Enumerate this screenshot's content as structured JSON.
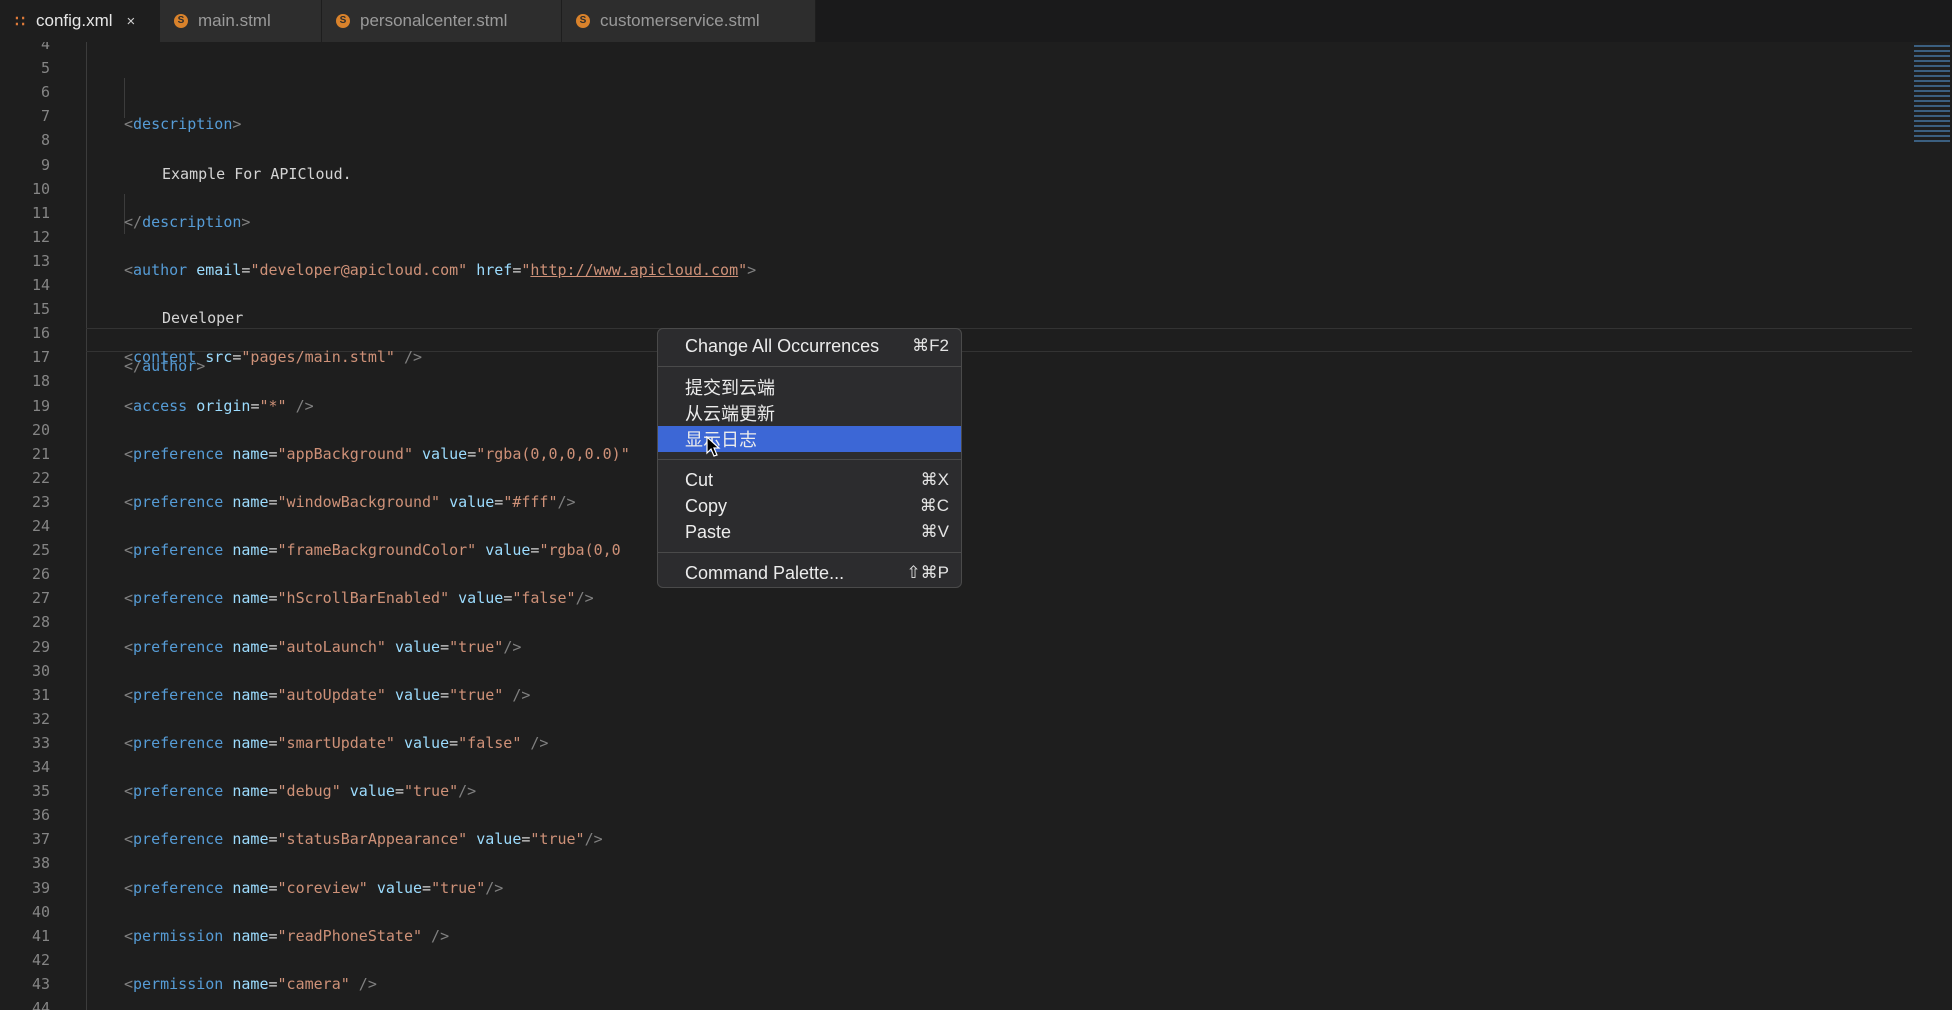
{
  "tabs": [
    {
      "label": "config.xml",
      "icon": "rss-icon",
      "active": true
    },
    {
      "label": "main.stml",
      "icon": "stml-icon"
    },
    {
      "label": "personalcenter.stml",
      "icon": "stml-icon"
    },
    {
      "label": "customerservice.stml",
      "icon": "stml-icon"
    }
  ],
  "tab_close": "×",
  "line_numbers": [
    "4",
    "5",
    "6",
    "7",
    "8",
    "9",
    "10",
    "11",
    "12",
    "13",
    "14",
    "15",
    "16",
    "17",
    "18",
    "19",
    "20",
    "21",
    "22",
    "23",
    "24",
    "25",
    "26",
    "27",
    "28",
    "29",
    "30",
    "31",
    "32",
    "33",
    "34",
    "35",
    "36",
    "37",
    "38",
    "39",
    "40",
    "41",
    "42",
    "43",
    "44"
  ],
  "code": {
    "l5": {
      "open": "<",
      "tag": "description",
      "close": ">"
    },
    "l7": {
      "text": "Example For APICloud."
    },
    "l9": {
      "open": "</",
      "tag": "description",
      "close": ">"
    },
    "l11": {
      "tag": "author",
      "a1": "email",
      "v1": "\"developer@apicloud.com\"",
      "a2": "href",
      "q": "\"",
      "url": "http://www.apicloud.com"
    },
    "l13": {
      "text": "Developer"
    },
    "l15": {
      "tag": "author"
    },
    "l17": {
      "tag": "content",
      "a1": "src",
      "v1": "\"pages/main.stml\"",
      "end": " />"
    },
    "l19": {
      "tag": "access",
      "a1": "origin",
      "v1": "\"*\"",
      "end": " />"
    },
    "l21": {
      "tag": "preference",
      "a1": "name",
      "v1": "\"appBackground\"",
      "a2": "value",
      "v2": "\"rgba(0,0,0,0.0)\""
    },
    "l23": {
      "tag": "preference",
      "a1": "name",
      "v1": "\"windowBackground\"",
      "a2": "value",
      "v2": "\"#fff\"",
      "end": "/>"
    },
    "l25": {
      "tag": "preference",
      "a1": "name",
      "v1": "\"frameBackgroundColor\"",
      "a2": "value",
      "v2": "\"rgba(0,0"
    },
    "l27": {
      "tag": "preference",
      "a1": "name",
      "v1": "\"hScrollBarEnabled\"",
      "a2": "value",
      "v2": "\"false\"",
      "end": "/>"
    },
    "l29": {
      "tag": "preference",
      "a1": "name",
      "v1": "\"autoLaunch\"",
      "a2": "value",
      "v2": "\"true\"",
      "end": "/>"
    },
    "l31": {
      "tag": "preference",
      "a1": "name",
      "v1": "\"autoUpdate\"",
      "a2": "value",
      "v2": "\"true\"",
      "end": " />"
    },
    "l33": {
      "tag": "preference",
      "a1": "name",
      "v1": "\"smartUpdate\"",
      "a2": "value",
      "v2": "\"false\"",
      "end": " />"
    },
    "l35": {
      "tag": "preference",
      "a1": "name",
      "v1": "\"debug\"",
      "a2": "value",
      "v2": "\"true\"",
      "end": "/>"
    },
    "l37": {
      "tag": "preference",
      "a1": "name",
      "v1": "\"statusBarAppearance\"",
      "a2": "value",
      "v2": "\"true\"",
      "end": "/>"
    },
    "l39": {
      "tag": "preference",
      "a1": "name",
      "v1": "\"coreview\"",
      "a2": "value",
      "v2": "\"true\"",
      "end": "/>"
    },
    "l41": {
      "tag": "permission",
      "a1": "name",
      "v1": "\"readPhoneState\"",
      "end": " />"
    },
    "l43": {
      "tag": "permission",
      "a1": "name",
      "v1": "\"camera\"",
      "end": " />"
    }
  },
  "context_menu": {
    "change_all": {
      "label": "Change All Occurrences",
      "shortcut": "⌘F2"
    },
    "submit_cloud": {
      "label": "提交到云端"
    },
    "update_cloud": {
      "label": "从云端更新"
    },
    "show_log": {
      "label": "显示日志"
    },
    "cut": {
      "label": "Cut",
      "shortcut": "⌘X"
    },
    "copy": {
      "label": "Copy",
      "shortcut": "⌘C"
    },
    "paste": {
      "label": "Paste",
      "shortcut": "⌘V"
    },
    "command_palette": {
      "label": "Command Palette...",
      "shortcut": "⇧⌘P"
    }
  }
}
